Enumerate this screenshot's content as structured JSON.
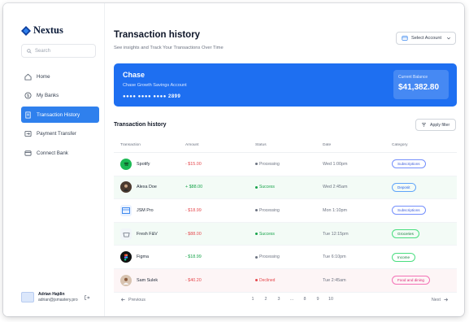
{
  "app": {
    "name": "Nextus"
  },
  "search": {
    "placeholder": "Search"
  },
  "sidebar": {
    "items": [
      {
        "label": "Home",
        "icon": "home-icon"
      },
      {
        "label": "My Banks",
        "icon": "dollar-icon"
      },
      {
        "label": "Transaction History",
        "icon": "receipt-icon",
        "active": true
      },
      {
        "label": "Payment Transfer",
        "icon": "transfer-icon"
      },
      {
        "label": "Connect Bank",
        "icon": "card-icon"
      }
    ],
    "user": {
      "name": "Adrian Hajdin",
      "email": "adrian@jsmastery.pro"
    }
  },
  "header": {
    "title": "Transaction history",
    "subtitle": "See insights and Track Your Transactions Over Time",
    "select_label": "Select Account"
  },
  "bank_card": {
    "name": "Chase",
    "account_type": "Chase Growth Savings Account",
    "mask": "●●●● ●●●● ●●●● 2899",
    "balance_label": "Current Balance",
    "balance": "$41,382.80"
  },
  "transactions": {
    "title": "Transaction history",
    "filter_label": "Apply filter",
    "columns": [
      "Transaction",
      "Amount",
      "Status",
      "Date",
      "Category"
    ],
    "rows": [
      {
        "name": "Spotify",
        "amount": "- $15.00",
        "status": "Processing",
        "date": "Wed 1:00pm",
        "category": "Subscriptions"
      },
      {
        "name": "Alexa Doe",
        "amount": "+ $88.00",
        "status": "Success",
        "date": "Wed 2:45am",
        "category": "Deposit"
      },
      {
        "name": "JSM Pro",
        "amount": "- $18.99",
        "status": "Processing",
        "date": "Mon 1:10pm",
        "category": "Subscriptions"
      },
      {
        "name": "Fresh F&V",
        "amount": "- $88.00",
        "status": "Success",
        "date": "Tue 12:15pm",
        "category": "Groceries"
      },
      {
        "name": "Figma",
        "amount": "- $18.99",
        "status": "Processing",
        "date": "Tue 6:10pm",
        "category": "Income"
      },
      {
        "name": "Sam Sulek",
        "amount": "- $40.20",
        "status": "Declined",
        "date": "Tue 2:45am",
        "category": "Food and dining"
      }
    ]
  },
  "pagination": {
    "prev_label": "Previous",
    "next_label": "Next",
    "pages": [
      "1",
      "2",
      "3",
      "...",
      "8",
      "9",
      "10"
    ]
  },
  "colors": {
    "brand": "#1e6ff1",
    "active_nav": "#2f80ed",
    "negative": "#e5484d",
    "positive": "#16a34a"
  }
}
